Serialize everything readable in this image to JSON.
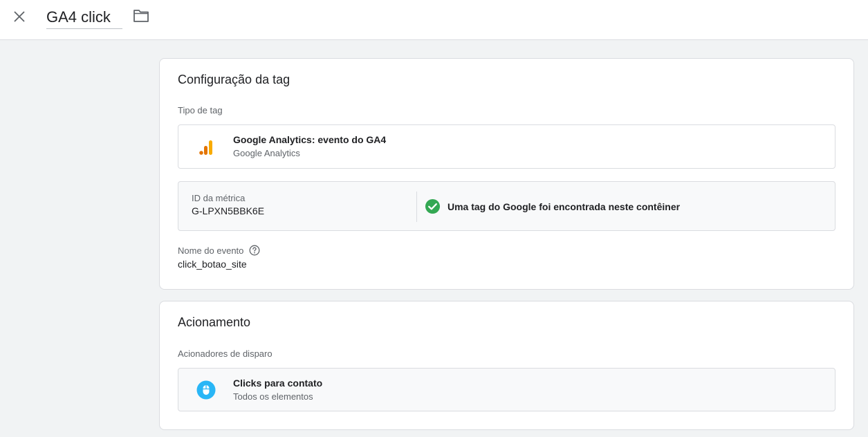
{
  "header": {
    "tag_name": "GA4 click",
    "close_icon": "close-icon",
    "folder_icon": "folder-icon"
  },
  "config": {
    "title": "Configuração da tag",
    "tag_type_label": "Tipo de tag",
    "tag_type": {
      "title": "Google Analytics: evento do GA4",
      "subtitle": "Google Analytics",
      "icon": "google-analytics-icon"
    },
    "metric": {
      "label": "ID da métrica",
      "value": "G-LPXN5BBK6E",
      "status_text": "Uma tag do Google foi encontrada neste contêiner",
      "status_icon": "check-circle-icon",
      "status_color": "#34a853"
    },
    "event": {
      "label": "Nome do evento",
      "value": "click_botao_site",
      "help_icon": "help-icon"
    }
  },
  "trigger": {
    "title": "Acionamento",
    "section_label": "Acionadores de disparo",
    "item": {
      "title": "Clicks para contato",
      "subtitle": "Todos os elementos",
      "icon": "mouse-icon",
      "icon_color": "#29b6f6"
    }
  }
}
